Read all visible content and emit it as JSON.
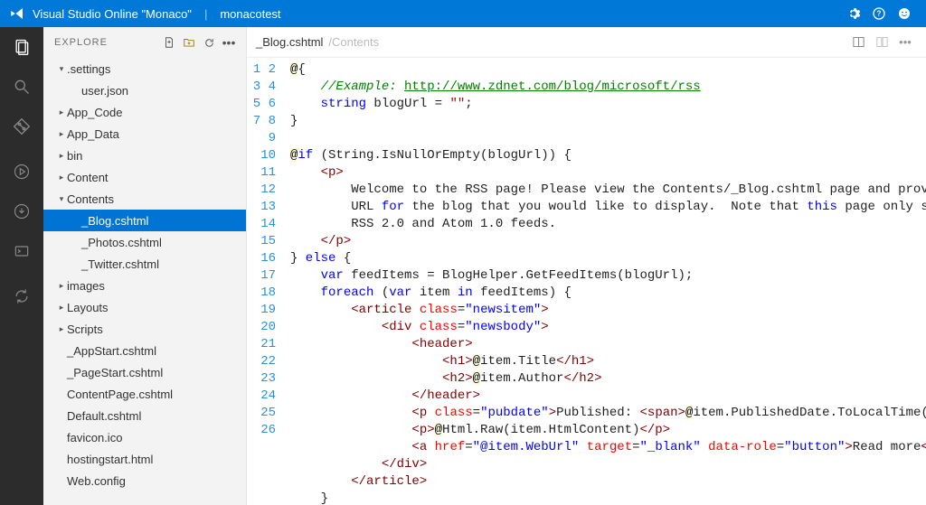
{
  "topbar": {
    "title": "Visual Studio Online \"Monaco\"",
    "separator": "|",
    "project": "monacotest"
  },
  "activity": {
    "explore": "Explore",
    "search": "Search",
    "git": "Git",
    "run": "Run",
    "output": "Output",
    "console": "Console",
    "sync": "Sync"
  },
  "sidebar": {
    "title": "EXPLORE",
    "tree": [
      {
        "label": ".settings",
        "depth": 0,
        "twisty": "▾"
      },
      {
        "label": "user.json",
        "depth": 1,
        "twisty": ""
      },
      {
        "label": "App_Code",
        "depth": 0,
        "twisty": "▸"
      },
      {
        "label": "App_Data",
        "depth": 0,
        "twisty": "▸"
      },
      {
        "label": "bin",
        "depth": 0,
        "twisty": "▸"
      },
      {
        "label": "Content",
        "depth": 0,
        "twisty": "▸"
      },
      {
        "label": "Contents",
        "depth": 0,
        "twisty": "▾"
      },
      {
        "label": "_Blog.cshtml",
        "depth": 1,
        "twisty": "",
        "selected": true
      },
      {
        "label": "_Photos.cshtml",
        "depth": 1,
        "twisty": ""
      },
      {
        "label": "_Twitter.cshtml",
        "depth": 1,
        "twisty": ""
      },
      {
        "label": "images",
        "depth": 0,
        "twisty": "▸"
      },
      {
        "label": "Layouts",
        "depth": 0,
        "twisty": "▸"
      },
      {
        "label": "Scripts",
        "depth": 0,
        "twisty": "▸"
      },
      {
        "label": "_AppStart.cshtml",
        "depth": 0,
        "twisty": ""
      },
      {
        "label": "_PageStart.cshtml",
        "depth": 0,
        "twisty": ""
      },
      {
        "label": "ContentPage.cshtml",
        "depth": 0,
        "twisty": ""
      },
      {
        "label": "Default.cshtml",
        "depth": 0,
        "twisty": ""
      },
      {
        "label": "favicon.ico",
        "depth": 0,
        "twisty": ""
      },
      {
        "label": "hostingstart.html",
        "depth": 0,
        "twisty": ""
      },
      {
        "label": "Web.config",
        "depth": 0,
        "twisty": ""
      }
    ]
  },
  "editor": {
    "tab_name": "_Blog.cshtml",
    "tab_folder": "/Contents",
    "code": {
      "comment_prefix": "//Example: ",
      "comment_url": "http://www.zdnet.com/blog/microsoft/rss",
      "kw_string": "string",
      "blog_decl": " blogUrl = ",
      "empty_str": "\"\"",
      "kw_if": "if",
      "if_cond": " (String.IsNullOrEmpty(blogUrl)) {",
      "welcome1": "        Welcome to the RSS page! Please view the Contents/_Blog.cshtml page and provide ",
      "welcome2a": "        URL ",
      "kw_for": "for",
      "welcome2b": " the blog that you would like to display.  Note that ",
      "kw_this": "this",
      "welcome2c": " page only suppo",
      "welcome3": "        RSS 2.0 and Atom 1.0 feeds.",
      "else": " else {",
      "kw_var": "var",
      "feed_decl": " feedItems = BlogHelper.GetFeedItems(blogUrl);",
      "kw_foreach": "foreach",
      "foreach_open": " (",
      "kw_var2": "var",
      "foreach_rest": " item ",
      "kw_in": "in",
      "foreach_rest2": " feedItems) {",
      "cls_newsitem": "\"newsitem\"",
      "cls_newsbody": "\"newsbody\"",
      "razor_title": "item.Title",
      "razor_author": "item.Author",
      "cls_pubdate": "\"pubdate\"",
      "pub_text": "Published: ",
      "razor_pubdate": "item.PublishedDate.ToLocalTime().Da",
      "razor_html": "Html.Raw(item.HtmlContent)",
      "href_val": "\"@item.WebUrl\"",
      "target_val": "\"_blank\"",
      "datarole_val": "\"button\"",
      "readmore": "Read more"
    }
  }
}
